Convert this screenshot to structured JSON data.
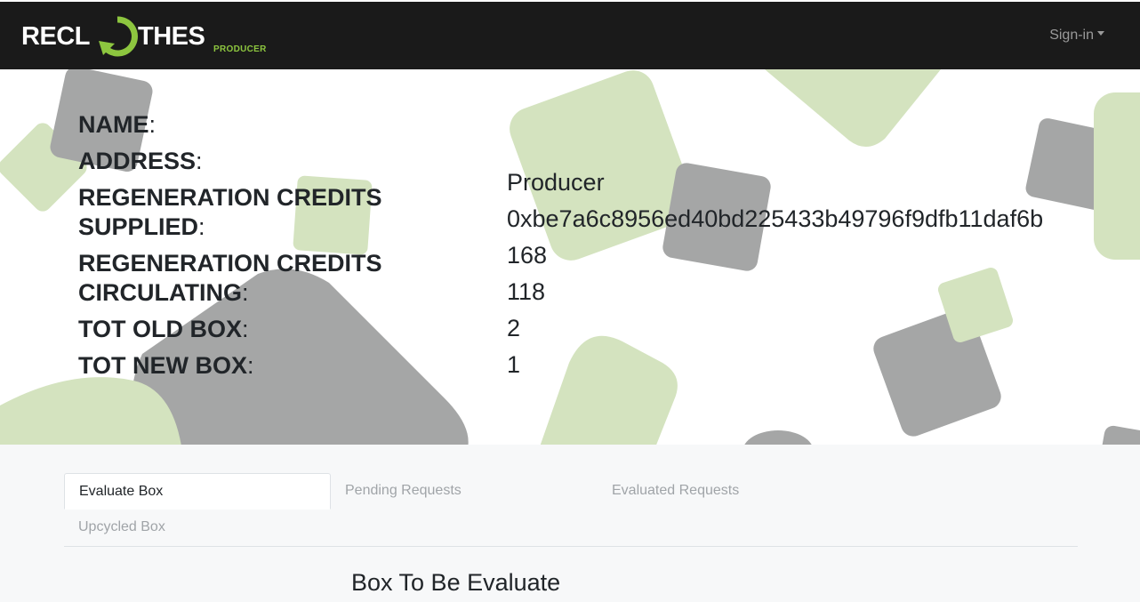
{
  "header": {
    "logo_left": "RECL",
    "logo_right": "THES",
    "logo_sub": "PRODUCER",
    "signin_label": "Sign-in"
  },
  "colors": {
    "navbar": "#1a1a1a",
    "brand_green": "#8dc63f",
    "shape_green": "#d4e3bf",
    "shape_gray": "#a5a6a6"
  },
  "profile": {
    "labels": {
      "name": "NAME",
      "address": "ADDRESS",
      "credits_supplied": "REGENERATION CREDITS SUPPLIED",
      "credits_circulating": "REGENERATION CREDITS CIRCULATING",
      "tot_old_box": "TOT OLD BOX",
      "tot_new_box": "TOT NEW BOX"
    },
    "values": {
      "name": "Producer",
      "address": "0xbe7a6c8956ed40bd225433b49796f9dfb11daf6b",
      "credits_supplied": "168",
      "credits_circulating": "118",
      "tot_old_box": "2",
      "tot_new_box": "1"
    }
  },
  "tabs": [
    {
      "label": "Evaluate Box",
      "active": true
    },
    {
      "label": "Pending Requests",
      "active": false
    },
    {
      "label": "Evaluated Requests",
      "active": false
    },
    {
      "label": "Upcycled Box",
      "active": false
    }
  ],
  "section_title": "Box To Be Evaluate"
}
